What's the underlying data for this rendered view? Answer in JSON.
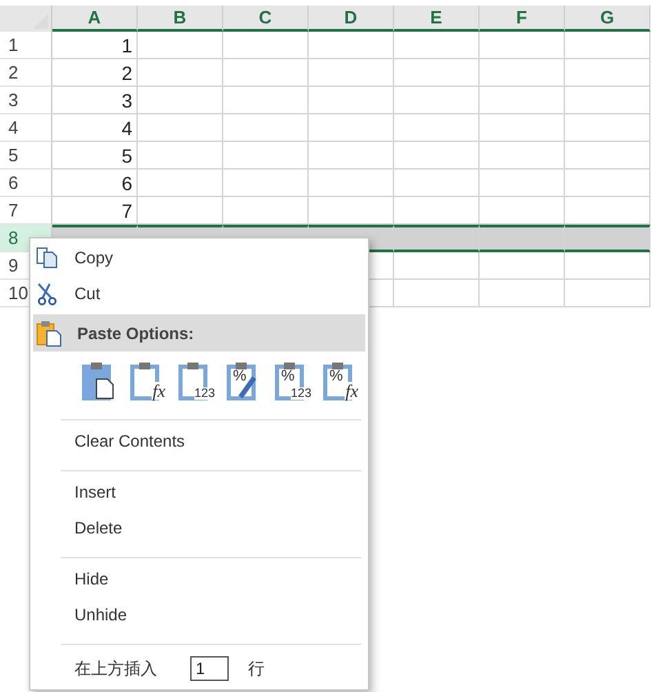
{
  "sheet": {
    "columns": [
      {
        "label": "A"
      },
      {
        "label": "B"
      },
      {
        "label": "C"
      },
      {
        "label": "D"
      },
      {
        "label": "E"
      },
      {
        "label": "F"
      },
      {
        "label": "G"
      }
    ],
    "rows": [
      {
        "header": "1",
        "selected": false,
        "value": "1"
      },
      {
        "header": "2",
        "selected": false,
        "value": "2"
      },
      {
        "header": "3",
        "selected": false,
        "value": "3"
      },
      {
        "header": "4",
        "selected": false,
        "value": "4"
      },
      {
        "header": "5",
        "selected": false,
        "value": "5"
      },
      {
        "header": "6",
        "selected": false,
        "value": "6"
      },
      {
        "header": "7",
        "selected": false,
        "value": "7"
      },
      {
        "header": "8",
        "selected": true
      },
      {
        "header": "9",
        "selected": false
      },
      {
        "header": "10",
        "selected": false
      }
    ]
  },
  "context_menu": {
    "groups": [
      [
        {
          "kind": "command",
          "label": "Copy"
        },
        {
          "kind": "command",
          "label": "Cut"
        },
        {
          "kind": "header",
          "label": "Paste Options:"
        },
        {
          "kind": "paste_options",
          "options": [
            {
              "kind": "paste"
            },
            {
              "kind": "formulas",
              "glyph": "fx"
            },
            {
              "kind": "values",
              "glyph": "123"
            },
            {
              "kind": "formatting",
              "mark": "%"
            },
            {
              "kind": "values_formatting",
              "mark": "%",
              "glyph": "123"
            },
            {
              "kind": "formulas_formatting",
              "mark": "%",
              "glyph": "fx"
            }
          ]
        }
      ],
      [
        {
          "kind": "command",
          "label": "Clear Contents"
        }
      ],
      [
        {
          "kind": "command",
          "label": "Insert"
        },
        {
          "kind": "command",
          "label": "Delete"
        }
      ],
      [
        {
          "kind": "command",
          "label": "Hide"
        },
        {
          "kind": "command",
          "label": "Unhide"
        }
      ],
      [
        {
          "kind": "insert_rows",
          "label": "在上方插入",
          "value": "1",
          "unit": "行"
        }
      ]
    ]
  }
}
